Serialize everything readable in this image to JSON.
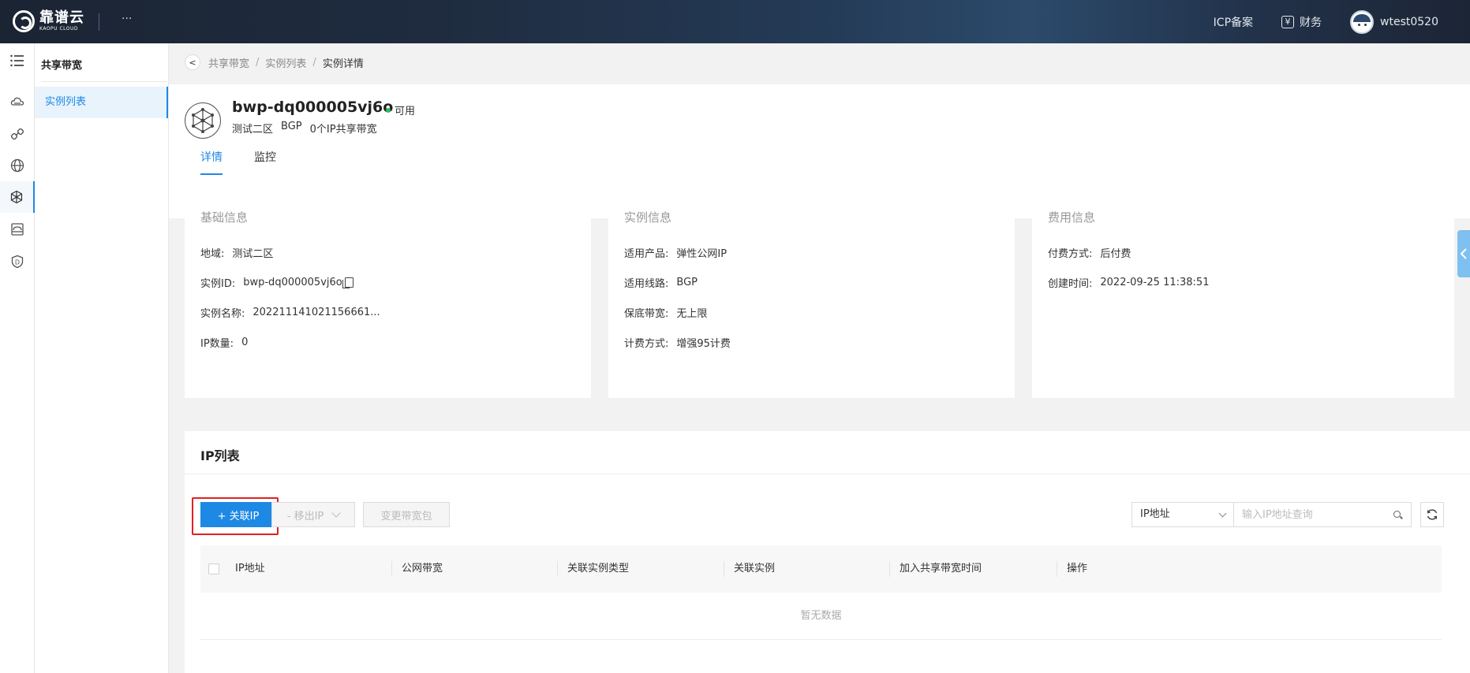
{
  "topbar": {
    "logo_cn": "靠谱云",
    "logo_en": "KAOPU CLOUD",
    "more": "···",
    "icp": "ICP备案",
    "finance_icon": "¥",
    "finance": "财务",
    "username": "wtest0520"
  },
  "rail": {
    "icons": [
      "menu-list-icon",
      "cloud-icon",
      "link-icon",
      "globe-icon",
      "network-icon",
      "storage-icon",
      "shield-d-icon"
    ]
  },
  "subnav": {
    "title": "共享带宽",
    "items": [
      {
        "label": "实例列表"
      }
    ]
  },
  "breadcrumb": {
    "back": "<",
    "items": [
      "共享带宽",
      "实例列表"
    ],
    "separator": "/",
    "current": "实例详情"
  },
  "instance": {
    "name": "bwp-dq000005vj6o",
    "status": "可用",
    "region": "测试二区",
    "line": "BGP",
    "ip_share": "0个IP共享带宽"
  },
  "tabs": [
    {
      "label": "详情"
    },
    {
      "label": "监控"
    }
  ],
  "basic": {
    "title": "基础信息",
    "rows": [
      {
        "k": "地域:",
        "v": "测试二区"
      },
      {
        "k": "实例ID:",
        "v": "bwp-dq000005vj6o"
      },
      {
        "k": "实例名称:",
        "v": "202211141021156661..."
      },
      {
        "k": "IP数量:",
        "v": "0"
      }
    ]
  },
  "inst_info": {
    "title": "实例信息",
    "rows": [
      {
        "k": "适用产品:",
        "v": "弹性公网IP"
      },
      {
        "k": "适用线路:",
        "v": "BGP"
      },
      {
        "k": "保底带宽:",
        "v": "无上限"
      },
      {
        "k": "计费方式:",
        "v": "增强95计费"
      }
    ]
  },
  "fee": {
    "title": "费用信息",
    "rows": [
      {
        "k": "付费方式:",
        "v": "后付费"
      },
      {
        "k": "创建时间:",
        "v": "2022-09-25 11:38:51"
      }
    ]
  },
  "ip_list": {
    "title": "IP列表",
    "associate_btn": "+ 关联IP",
    "remove_btn": "- 移出IP",
    "change_btn": "变更带宽包",
    "filter_select": "IP地址",
    "search_placeholder": "输入IP地址查询",
    "columns": [
      "IP地址",
      "公网带宽",
      "关联实例类型",
      "关联实例",
      "加入共享带宽时间",
      "操作"
    ],
    "empty": "暂无数据"
  },
  "colors": {
    "primary": "#1e88e5",
    "status_green": "#2bbd5a",
    "highlight_red": "#e02020"
  }
}
